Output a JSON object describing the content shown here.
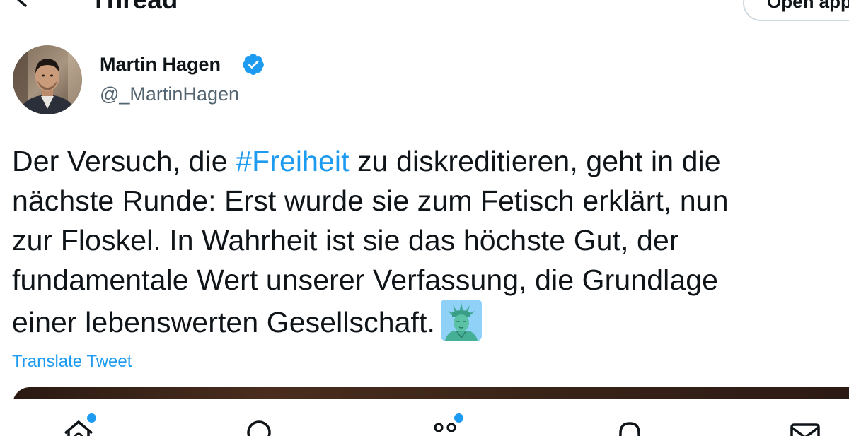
{
  "header": {
    "title": "Thread",
    "open_app_label": "Open app"
  },
  "author": {
    "name": "Martin Hagen",
    "handle": "@_MartinHagen",
    "verified": true
  },
  "tweet": {
    "lines": [
      {
        "before": "Der Versuch, die ",
        "hashtag": "#Freiheit",
        "after": " zu diskreditieren, geht in die"
      },
      {
        "text": "nächste Runde: Erst wurde sie zum Fetisch erklärt, nun"
      },
      {
        "text": "zur Floskel. In Wahrheit ist sie das höchste Gut, der"
      },
      {
        "text": "fundamentale Wert unserer Verfassung, die Grundlage"
      },
      {
        "text": "einer lebenswerten Gesellschaft."
      }
    ],
    "emoji": "statue-of-liberty",
    "translate_label": "Translate Tweet"
  },
  "colors": {
    "accent": "#1d9bf0",
    "text": "#0f1419",
    "secondary": "#536471"
  },
  "bottom_nav": {
    "items": [
      "home-icon",
      "search-icon",
      "spaces-icon",
      "notifications-icon",
      "messages-icon"
    ],
    "badges": {
      "home": true,
      "spaces": true
    }
  }
}
